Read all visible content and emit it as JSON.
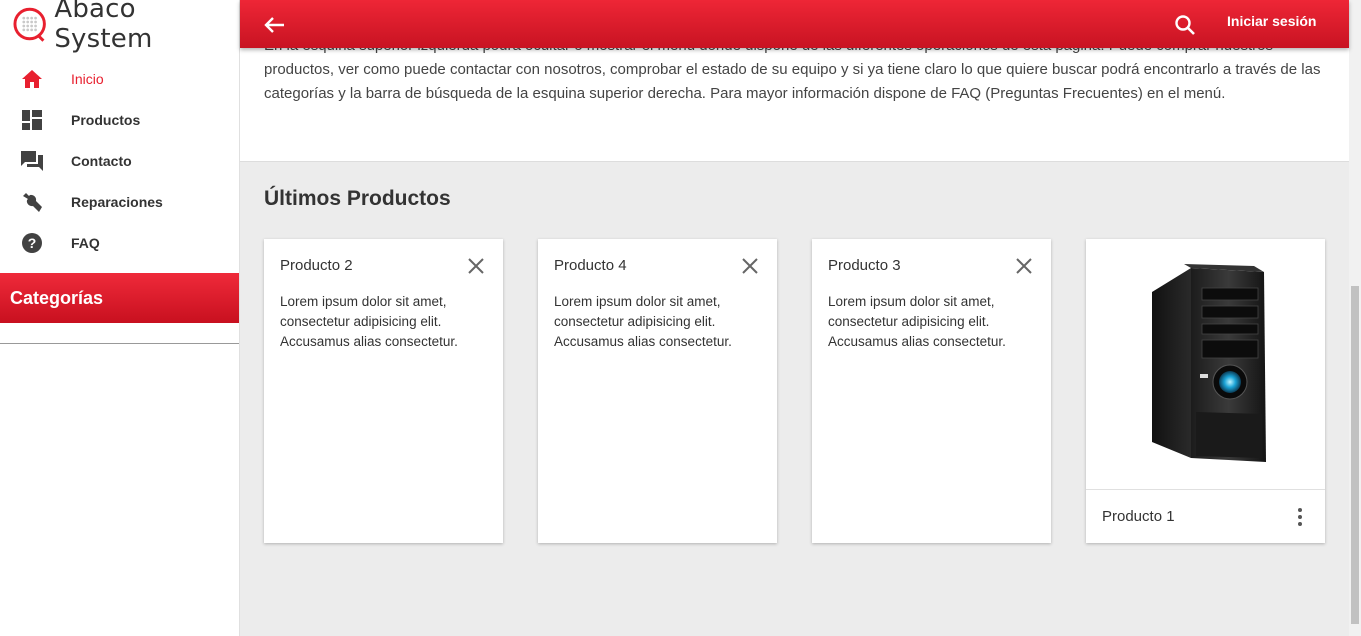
{
  "app": {
    "title": "Abaco System"
  },
  "sidebar": {
    "items": [
      {
        "label": "Inicio",
        "icon": "home-icon",
        "active": true
      },
      {
        "label": "Productos",
        "icon": "dashboard-icon",
        "active": false
      },
      {
        "label": "Contacto",
        "icon": "forum-icon",
        "active": false
      },
      {
        "label": "Reparaciones",
        "icon": "wrench-icon",
        "active": false
      },
      {
        "label": "FAQ",
        "icon": "help-icon",
        "active": false
      }
    ],
    "categories_title": "Categorías"
  },
  "topbar": {
    "login_label": "Iniciar sesión"
  },
  "main": {
    "intro_text": "En la esquina superior izquierda podrá ocultar o mostrar el menú donde dispone de las diferentes operaciones de esta página. Puede comprar nuestros productos, ver como puede contactar con nosotros, comprobar el estado de su equipo y si ya tiene claro lo que quiere buscar podrá encontrarlo a través de las categorías y la barra de búsqueda de la esquina superior derecha. Para mayor información dispone de FAQ (Preguntas Frecuentes) en el menú.",
    "section_title": "Últimos Productos",
    "cards": [
      {
        "title": "Producto 2",
        "body": "Lorem ipsum dolor sit amet, consectetur adipisicing elit. Accusamus alias consectetur."
      },
      {
        "title": "Producto 4",
        "body": "Lorem ipsum dolor sit amet, consectetur adipisicing elit. Accusamus alias consectetur."
      },
      {
        "title": "Producto 3",
        "body": "Lorem ipsum dolor sit amet, consectetur adipisicing elit. Accusamus alias consectetur."
      },
      {
        "title": "Producto 1"
      }
    ]
  },
  "colors": {
    "accent": "#e8202f",
    "background": "#ececec"
  }
}
